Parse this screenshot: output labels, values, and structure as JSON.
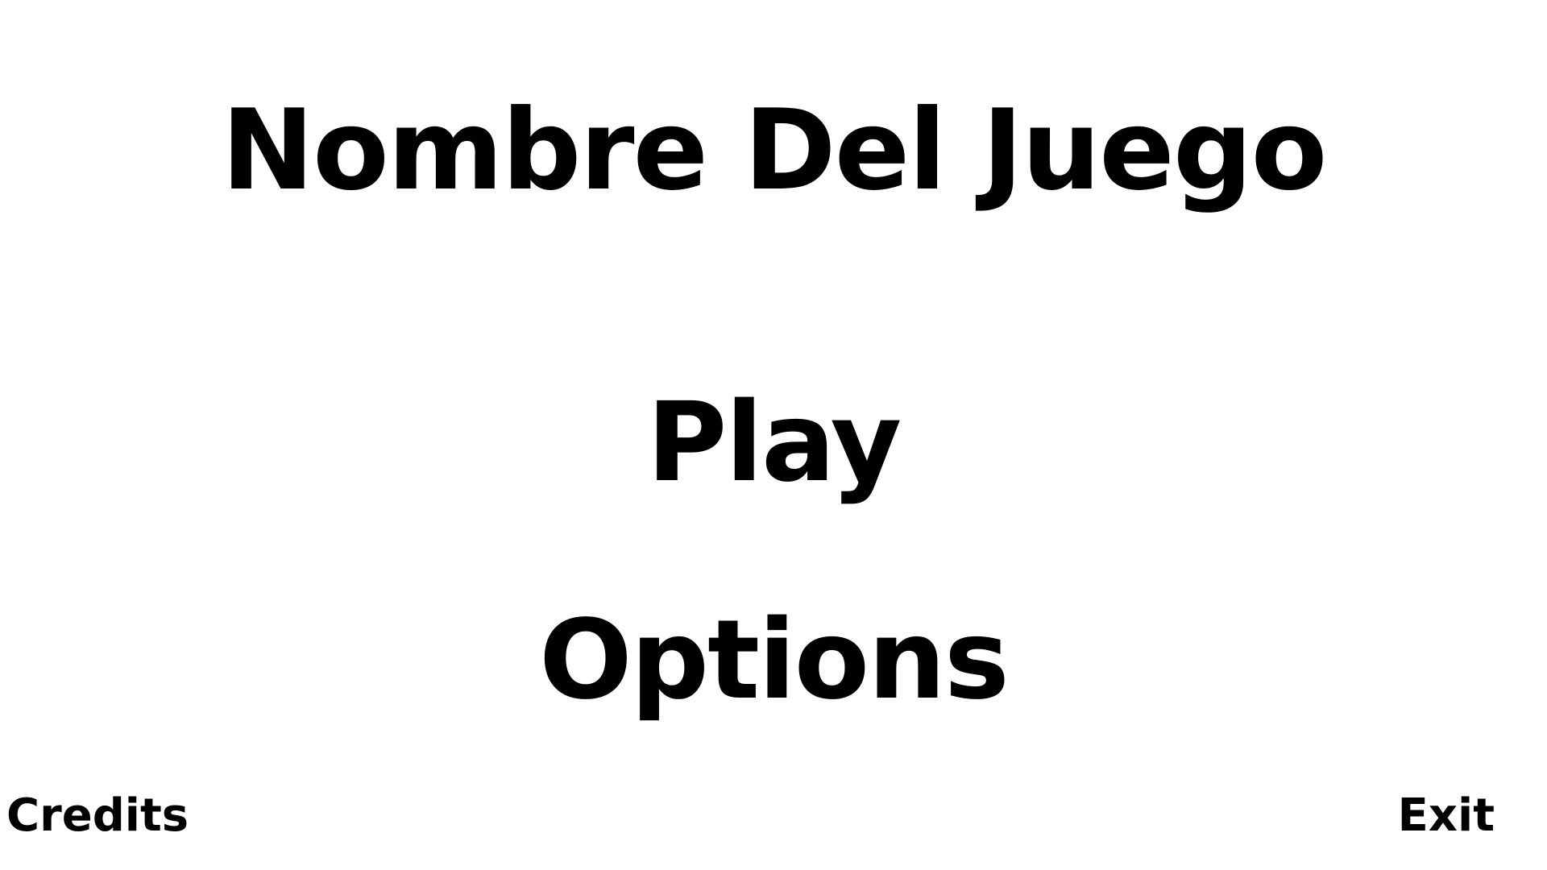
{
  "title": "Nombre Del Juego",
  "menu": {
    "play_label": "Play",
    "options_label": "Options"
  },
  "footer": {
    "credits_label": "Credits",
    "exit_label": "Exit"
  },
  "colors": {
    "background": "#ffffff",
    "text": "#000000"
  }
}
